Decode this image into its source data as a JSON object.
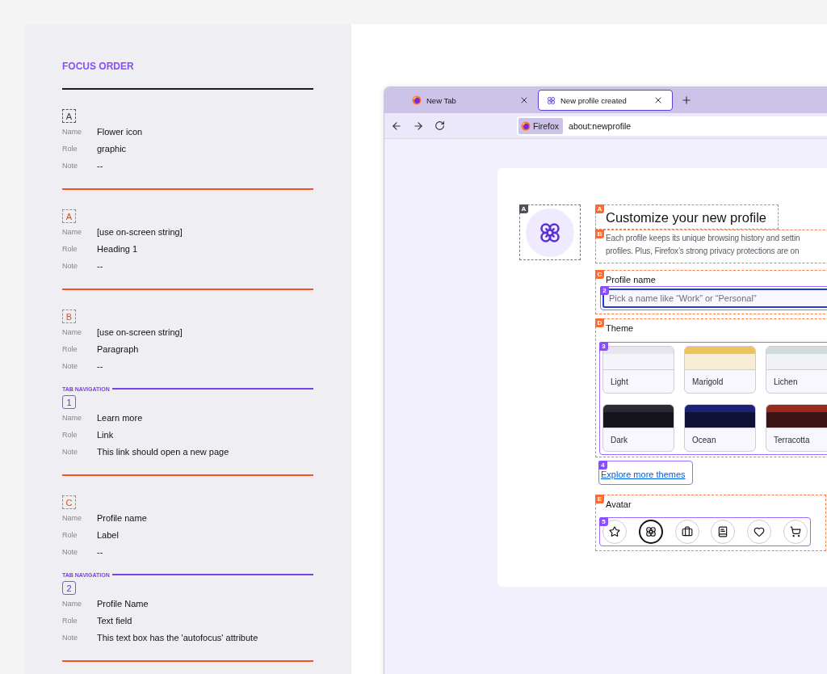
{
  "annotations": {
    "title": "FOCUS ORDER",
    "entries": [
      {
        "kind": "graphic",
        "badge": "A",
        "fields": [
          {
            "label": "Name",
            "value": "Flower icon"
          },
          {
            "label": "Role",
            "value": "graphic"
          },
          {
            "label": "Note",
            "value": "--"
          }
        ]
      },
      {
        "kind": "annotation",
        "badge": "A",
        "fields": [
          {
            "label": "Name",
            "value": "[use on-screen string]"
          },
          {
            "label": "Role",
            "value": "Heading 1"
          },
          {
            "label": "Note",
            "value": "--"
          }
        ]
      },
      {
        "kind": "annotation",
        "badge": "B",
        "fields": [
          {
            "label": "Name",
            "value": "[use on-screen string]"
          },
          {
            "label": "Role",
            "value": "Paragraph"
          },
          {
            "label": "Note",
            "value": "--"
          }
        ]
      },
      {
        "kind": "tab",
        "section_label": "TAB NAVIGATION",
        "badge": "1",
        "fields": [
          {
            "label": "Name",
            "value": "Learn more"
          },
          {
            "label": "Role",
            "value": "Link"
          },
          {
            "label": "Note",
            "value": "This link should open a new page"
          }
        ]
      },
      {
        "kind": "annotation",
        "badge": "C",
        "fields": [
          {
            "label": "Name",
            "value": "Profile name"
          },
          {
            "label": "Role",
            "value": "Label"
          },
          {
            "label": "Note",
            "value": "--"
          }
        ]
      },
      {
        "kind": "tab",
        "section_label": "TAB NAVIGATION",
        "badge": "2",
        "fields": [
          {
            "label": "Name",
            "value": "Profile Name"
          },
          {
            "label": "Role",
            "value": "Text field"
          },
          {
            "label": "Note",
            "value": "This text box has the 'autofocus' attribute"
          }
        ]
      }
    ]
  },
  "browser": {
    "tabs": [
      {
        "title": "New Tab",
        "selected": false
      },
      {
        "title": "New profile created",
        "selected": true
      }
    ],
    "identity": "Firefox",
    "url": "about:newprofile"
  },
  "page": {
    "icon_badge": "A",
    "heading": {
      "badge": "A",
      "text": "Customize your new profile"
    },
    "description": {
      "badge": "B",
      "lines": [
        "Each profile keeps its unique browsing history and settin",
        "profiles. Plus, Firefox’s strong privacy protections are on"
      ]
    },
    "profile_name": {
      "badge": "C",
      "label": "Profile name",
      "field_badge": "2",
      "placeholder": "Pick a name like “Work” or “Personal”"
    },
    "theme": {
      "badge": "D",
      "label": "Theme",
      "grid_badge": "3",
      "themes": [
        {
          "name": "Light",
          "kind": "light",
          "color": "#e6e4ee"
        },
        {
          "name": "Marigold",
          "kind": "light",
          "color": "#eec35a"
        },
        {
          "name": "Lichen",
          "kind": "light",
          "color": "#cfdcd8"
        },
        {
          "name": "Dark",
          "kind": "dark",
          "color": "#2b2a33"
        },
        {
          "name": "Ocean",
          "kind": "dark",
          "color": "#1a2378"
        },
        {
          "name": "Terracotta",
          "kind": "dark",
          "color": "#9b2a1e"
        }
      ],
      "link_badge": "4",
      "link": "Explore more themes"
    },
    "avatar": {
      "badge": "E",
      "label": "Avatar",
      "list_badge": "5",
      "avatars": [
        {
          "selected": false
        },
        {
          "selected": true
        },
        {
          "selected": false
        },
        {
          "selected": false
        },
        {
          "selected": false
        },
        {
          "selected": false
        }
      ]
    }
  }
}
